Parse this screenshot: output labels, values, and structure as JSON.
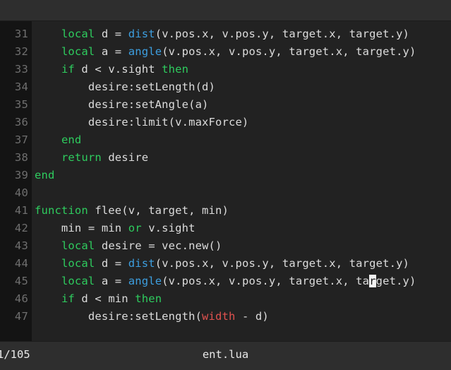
{
  "window": {
    "title": "ent.lua"
  },
  "topbar": {
    "label": ""
  },
  "editor": {
    "language": "lua",
    "colors": {
      "background": "#222222",
      "gutter_background": "#141414",
      "linenumber": "#6f6f6f",
      "text": "#dcdcdc",
      "keyword": "#2ecc5e",
      "function": "#3d9fe0",
      "global": "#e0524f",
      "cursor": "#f2f2f2",
      "bar": "#2e2e2e"
    },
    "lines": [
      {
        "number": "31",
        "tokens": [
          {
            "t": "    ",
            "c": "txt"
          },
          {
            "t": "local",
            "c": "kw"
          },
          {
            "t": " d = ",
            "c": "txt"
          },
          {
            "t": "dist",
            "c": "fn"
          },
          {
            "t": "(v.pos.x, v.pos.y, target.x, target.y)",
            "c": "txt"
          }
        ]
      },
      {
        "number": "32",
        "tokens": [
          {
            "t": "    ",
            "c": "txt"
          },
          {
            "t": "local",
            "c": "kw"
          },
          {
            "t": " a = ",
            "c": "txt"
          },
          {
            "t": "angle",
            "c": "fn"
          },
          {
            "t": "(v.pos.x, v.pos.y, target.x, target.y)",
            "c": "txt"
          }
        ]
      },
      {
        "number": "33",
        "tokens": [
          {
            "t": "    ",
            "c": "txt"
          },
          {
            "t": "if",
            "c": "kw"
          },
          {
            "t": " d < v.sight ",
            "c": "txt"
          },
          {
            "t": "then",
            "c": "kw"
          }
        ]
      },
      {
        "number": "34",
        "tokens": [
          {
            "t": "        desire:setLength(d)",
            "c": "txt"
          }
        ]
      },
      {
        "number": "35",
        "tokens": [
          {
            "t": "        desire:setAngle(a)",
            "c": "txt"
          }
        ]
      },
      {
        "number": "36",
        "tokens": [
          {
            "t": "        desire:limit(v.maxForce)",
            "c": "txt"
          }
        ]
      },
      {
        "number": "37",
        "tokens": [
          {
            "t": "    ",
            "c": "txt"
          },
          {
            "t": "end",
            "c": "kw"
          }
        ]
      },
      {
        "number": "38",
        "tokens": [
          {
            "t": "    ",
            "c": "txt"
          },
          {
            "t": "return",
            "c": "kw"
          },
          {
            "t": " desire",
            "c": "txt"
          }
        ]
      },
      {
        "number": "39",
        "tokens": [
          {
            "t": "end",
            "c": "kw"
          }
        ]
      },
      {
        "number": "40",
        "tokens": []
      },
      {
        "number": "41",
        "tokens": [
          {
            "t": "function",
            "c": "kw"
          },
          {
            "t": " flee(v, target, min)",
            "c": "txt"
          }
        ]
      },
      {
        "number": "42",
        "tokens": [
          {
            "t": "    min = min ",
            "c": "txt"
          },
          {
            "t": "or",
            "c": "kw"
          },
          {
            "t": " v.sight",
            "c": "txt"
          }
        ]
      },
      {
        "number": "43",
        "tokens": [
          {
            "t": "    ",
            "c": "txt"
          },
          {
            "t": "local",
            "c": "kw"
          },
          {
            "t": " desire = vec.new()",
            "c": "txt"
          }
        ]
      },
      {
        "number": "44",
        "tokens": [
          {
            "t": "    ",
            "c": "txt"
          },
          {
            "t": "local",
            "c": "kw"
          },
          {
            "t": " d = ",
            "c": "txt"
          },
          {
            "t": "dist",
            "c": "fn"
          },
          {
            "t": "(v.pos.x, v.pos.y, target.x, target.y)",
            "c": "txt"
          }
        ]
      },
      {
        "number": "45",
        "tokens": [
          {
            "t": "    ",
            "c": "txt"
          },
          {
            "t": "local",
            "c": "kw"
          },
          {
            "t": " a = ",
            "c": "txt"
          },
          {
            "t": "angle",
            "c": "fn"
          },
          {
            "t": "(v.pos.x, v.pos.y, target.x, ta",
            "c": "txt"
          },
          {
            "t": "r",
            "c": "cursor"
          },
          {
            "t": "get.y)",
            "c": "txt"
          }
        ]
      },
      {
        "number": "46",
        "tokens": [
          {
            "t": "    ",
            "c": "txt"
          },
          {
            "t": "if",
            "c": "kw"
          },
          {
            "t": " d < min ",
            "c": "txt"
          },
          {
            "t": "then",
            "c": "kw"
          }
        ]
      },
      {
        "number": "47",
        "tokens": [
          {
            "t": "        desire:setLength(",
            "c": "txt"
          },
          {
            "t": "width",
            "c": "glob"
          },
          {
            "t": " - d)",
            "c": "txt"
          }
        ]
      }
    ]
  },
  "statusbar": {
    "position": "1/105",
    "filename": "ent.lua"
  }
}
